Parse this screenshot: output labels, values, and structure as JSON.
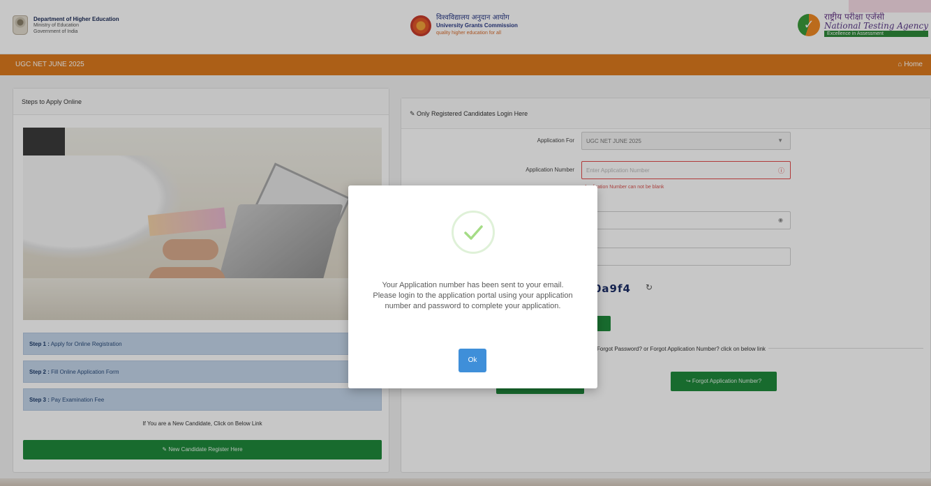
{
  "header": {
    "moe_line1": "Department of Higher Education",
    "moe_line2": "Ministry of Education",
    "moe_line3": "Government of India",
    "ugc_hindi": "विश्वविद्यालय अनुदान आयोग",
    "ugc_english": "University Grants Commission",
    "ugc_tagline": "quality higher education for all",
    "nta_hindi": "राष्ट्रीय परीक्षा एजेंसी",
    "nta_english": "National Testing Agency",
    "nta_tagline": "Excellence in Assessment"
  },
  "nav": {
    "title": "UGC NET JUNE 2025",
    "home": "⌂ Home"
  },
  "left_panel": {
    "heading": "Steps to Apply Online",
    "steps": [
      {
        "num": "Step 1 :",
        "text": "Apply for Online Registration"
      },
      {
        "num": "Step 2 :",
        "text": "Fill Online Application Form"
      },
      {
        "num": "Step 3 :",
        "text": "Pay Examination Fee"
      }
    ],
    "new_candidate_text": "If You are a New Candidate, Click on Below Link",
    "register_button": "✎ New Candidate Register Here"
  },
  "right_panel": {
    "heading": "✎ Only Registered Candidates Login Here",
    "application_for_label": "Application For",
    "application_for_value": "UGC NET JUNE 2025",
    "application_number_label": "Application Number",
    "application_number_placeholder": "Enter Application Number",
    "application_number_error": "Application Number can not be blank",
    "captcha_text": "0a9f4",
    "forgot_text": "Forgot Password? or Forgot Application Number? click on below link",
    "forgot_app_button": "↪ Forgot Application Number?"
  },
  "modal": {
    "message": "Your Application number has been sent to your email. Please login to the application portal using your application number and password to complete your application.",
    "ok_label": "Ok"
  }
}
